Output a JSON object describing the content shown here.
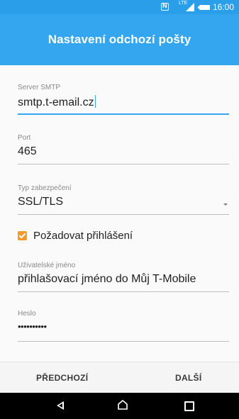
{
  "status_bar": {
    "lte_label": "LTE",
    "time": "16:00"
  },
  "header": {
    "title": "Nastavení odchozí pošty"
  },
  "form": {
    "server": {
      "label": "Server SMTP",
      "value": "smtp.t-email.cz"
    },
    "port": {
      "label": "Port",
      "value": "465"
    },
    "security": {
      "label": "Typ zabezpečení",
      "value": "SSL/TLS"
    },
    "require_login": {
      "label": "Požadovat přihlášení",
      "checked": true
    },
    "username": {
      "label": "Uživatelské jméno",
      "value": "přihlašovací jméno do Můj T-Mobile"
    },
    "password": {
      "label": "Heslo",
      "value": "••••••••••"
    }
  },
  "actions": {
    "previous_label": "PŘEDCHOZÍ",
    "next_label": "DALŠÍ"
  },
  "colors": {
    "accent": "#34a6f0",
    "status_bar": "#2a9ee9",
    "checkbox": "#f39a2e"
  },
  "icons": [
    "nfc-icon",
    "signal-icon",
    "battery-icon",
    "back-icon",
    "home-icon",
    "recent-apps-icon",
    "dropdown-arrow-icon"
  ]
}
